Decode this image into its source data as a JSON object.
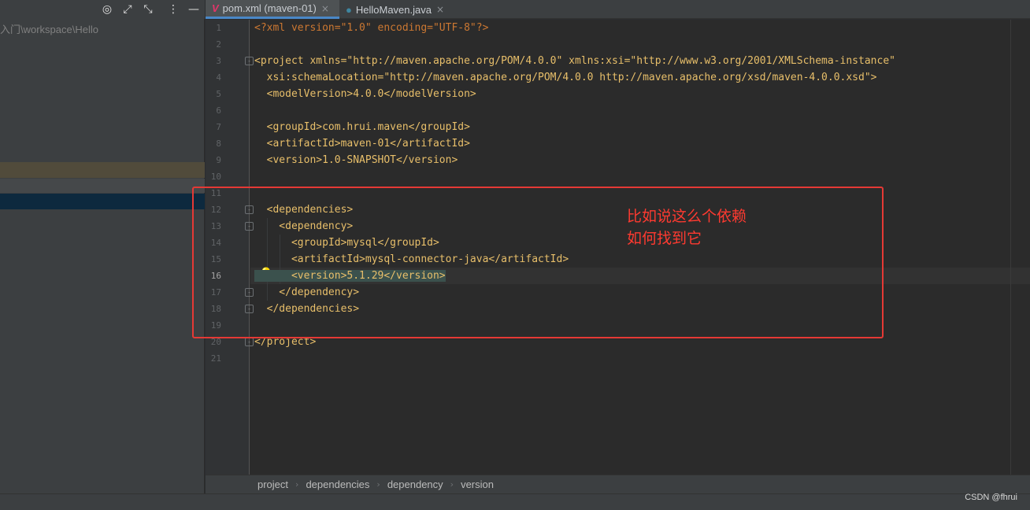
{
  "left_panel": {
    "path_text": "入门\\workspace\\Hello",
    "toolbar": [
      "target-icon",
      "expand-icon",
      "collapse-icon",
      "more-icon",
      "minimize-icon"
    ]
  },
  "tabs": [
    {
      "label": "pom.xml (maven-01)",
      "icon": "maven-icon",
      "active": true
    },
    {
      "label": "HelloMaven.java",
      "icon": "java-class-icon",
      "active": false
    }
  ],
  "tab_close": "×",
  "editor": {
    "line_numbers": [
      "1",
      "2",
      "3",
      "4",
      "5",
      "6",
      "7",
      "8",
      "9",
      "10",
      "11",
      "12",
      "13",
      "14",
      "15",
      "16",
      "17",
      "18",
      "19",
      "20",
      "21"
    ],
    "current_line": "16",
    "lines": [
      "<?xml version=\"1.0\" encoding=\"UTF-8\"?>",
      "",
      "<project xmlns=\"http://maven.apache.org/POM/4.0.0\" xmlns:xsi=\"http://www.w3.org/2001/XMLSchema-instance\"",
      "  xsi:schemaLocation=\"http://maven.apache.org/POM/4.0.0 http://maven.apache.org/xsd/maven-4.0.0.xsd\">",
      "  <modelVersion>4.0.0</modelVersion>",
      "",
      "  <groupId>com.hrui.maven</groupId>",
      "  <artifactId>maven-01</artifactId>",
      "  <version>1.0-SNAPSHOT</version>",
      "",
      "",
      "  <dependencies>",
      "    <dependency>",
      "      <groupId>mysql</groupId>",
      "      <artifactId>mysql-connector-java</artifactId>",
      "      <version>5.1.29</version>",
      "    </dependency>",
      "  </dependencies>",
      "",
      "</project>",
      ""
    ],
    "annotation": "比如说这么个依赖\n如何找到它"
  },
  "breadcrumb": [
    "project",
    "dependencies",
    "dependency",
    "version"
  ],
  "breadcrumb_separator": "›",
  "watermark": "CSDN @fhrui",
  "colors": {
    "accent": "#4a88c7",
    "tag": "#e8bf6a",
    "string": "#6a8759",
    "annotation": "#ff3a30"
  }
}
